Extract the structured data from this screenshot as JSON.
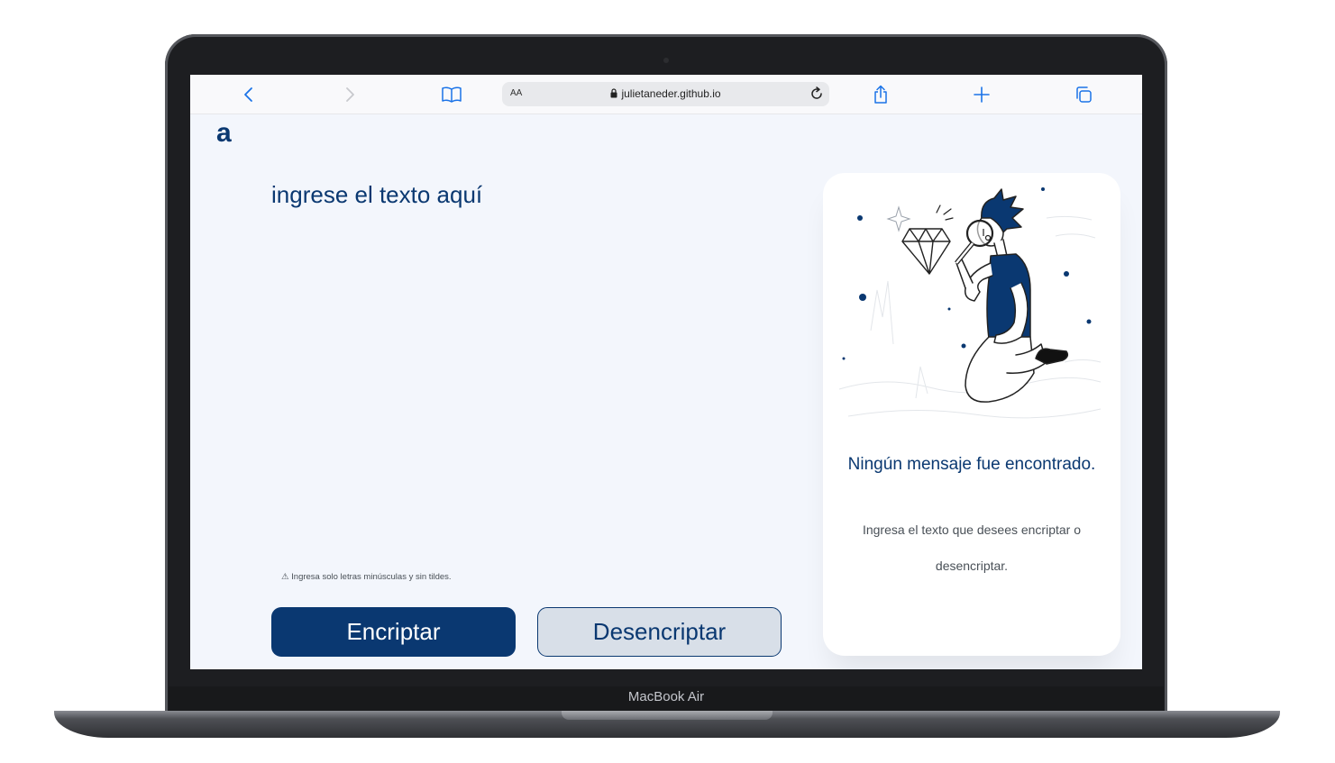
{
  "device": {
    "model_label": "MacBook Air"
  },
  "browser": {
    "text_size_label": "AA",
    "url": "julietaneder.github.io",
    "icons": [
      "chevron-left-icon",
      "chevron-right-icon",
      "book-icon",
      "lock-icon",
      "reload-icon",
      "share-icon",
      "plus-icon",
      "tabs-icon"
    ],
    "accent_color": "#1a73e8"
  },
  "app": {
    "logo_text": "a",
    "input_placeholder": "ingrese el texto aquí",
    "hint": "⚠ Ingresa solo letras minúsculas y sin tildes.",
    "encrypt_label": "Encriptar",
    "decrypt_label": "Desencriptar",
    "output": {
      "title": "Ningún mensaje fue encontrado.",
      "text": "Ingresa el texto que desees encriptar o desencriptar."
    },
    "colors": {
      "primary": "#0a3871",
      "background": "#f3f6fc",
      "secondary_button": "#d8dfe8"
    }
  }
}
